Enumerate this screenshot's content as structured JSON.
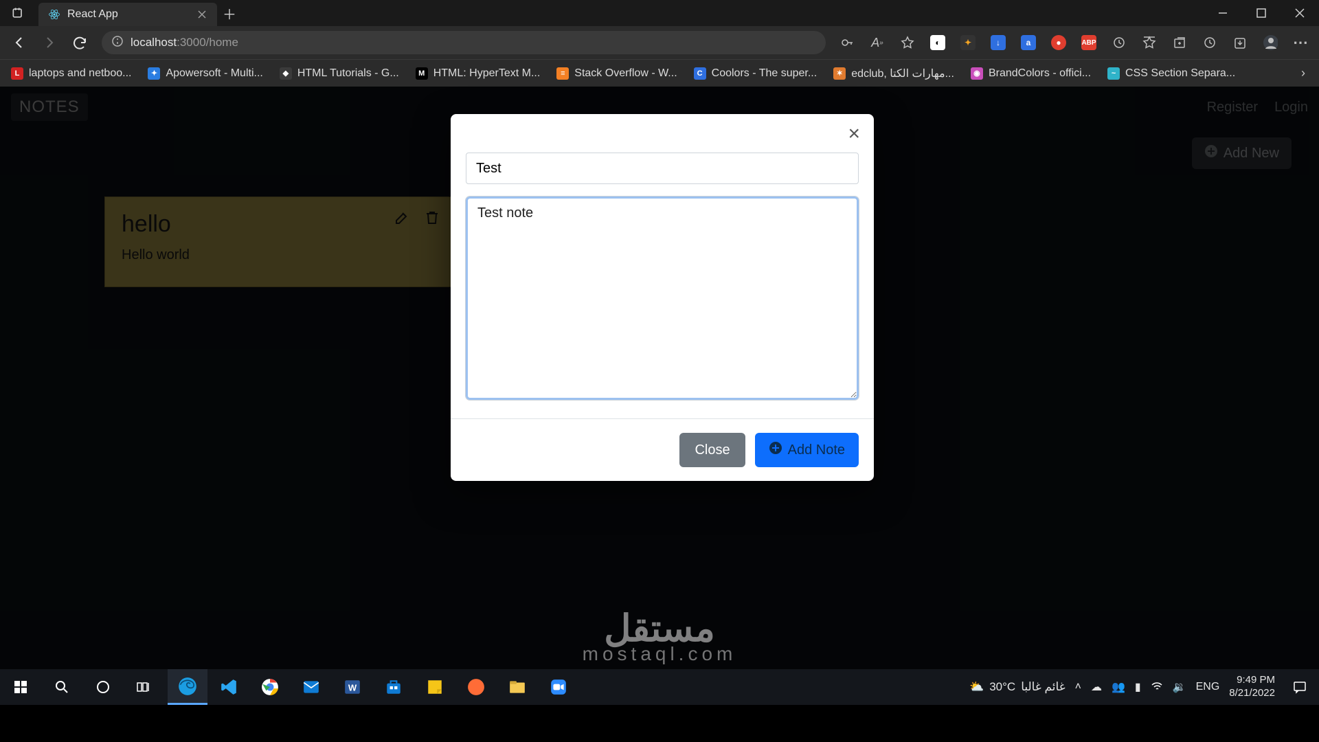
{
  "browser": {
    "tab_title": "React App",
    "url_host": "localhost",
    "url_path": ":3000/home",
    "bookmarks": [
      {
        "label": "laptops and netboo...",
        "icon_bg": "#d22222",
        "icon_txt": "L"
      },
      {
        "label": "Apowersoft - Multi...",
        "icon_bg": "#2a7de1",
        "icon_txt": "✦"
      },
      {
        "label": "HTML Tutorials - G...",
        "icon_bg": "#3a3a3a",
        "icon_txt": "◆"
      },
      {
        "label": "HTML: HyperText M...",
        "icon_bg": "#000",
        "icon_txt": "M"
      },
      {
        "label": "Stack Overflow - W...",
        "icon_bg": "#f48024",
        "icon_txt": "≡"
      },
      {
        "label": "Coolors - The super...",
        "icon_bg": "#2f6fe0",
        "icon_txt": "C"
      },
      {
        "label": "edclub, مهارات الكتا...",
        "icon_bg": "#e07b2f",
        "icon_txt": "✶"
      },
      {
        "label": "BrandColors - offici...",
        "icon_bg": "#c94fbb",
        "icon_txt": "◉"
      },
      {
        "label": "CSS Section Separa...",
        "icon_bg": "#2fb3c9",
        "icon_txt": "~"
      }
    ]
  },
  "app": {
    "brand": "NOTES",
    "nav_register": "Register",
    "nav_login": "Login",
    "add_new_label": "Add New",
    "note": {
      "title": "hello",
      "body": "Hello world"
    }
  },
  "modal": {
    "title_value": "Test",
    "body_value": "Test note",
    "close_label": "Close",
    "add_label": "Add Note"
  },
  "watermark": {
    "arabic": "مستقل",
    "latin": "mostaql.com"
  },
  "taskbar": {
    "weather_temp": "30°C",
    "weather_desc": "غائم غالبا",
    "lang": "ENG",
    "time": "9:49 PM",
    "date": "8/21/2022"
  }
}
